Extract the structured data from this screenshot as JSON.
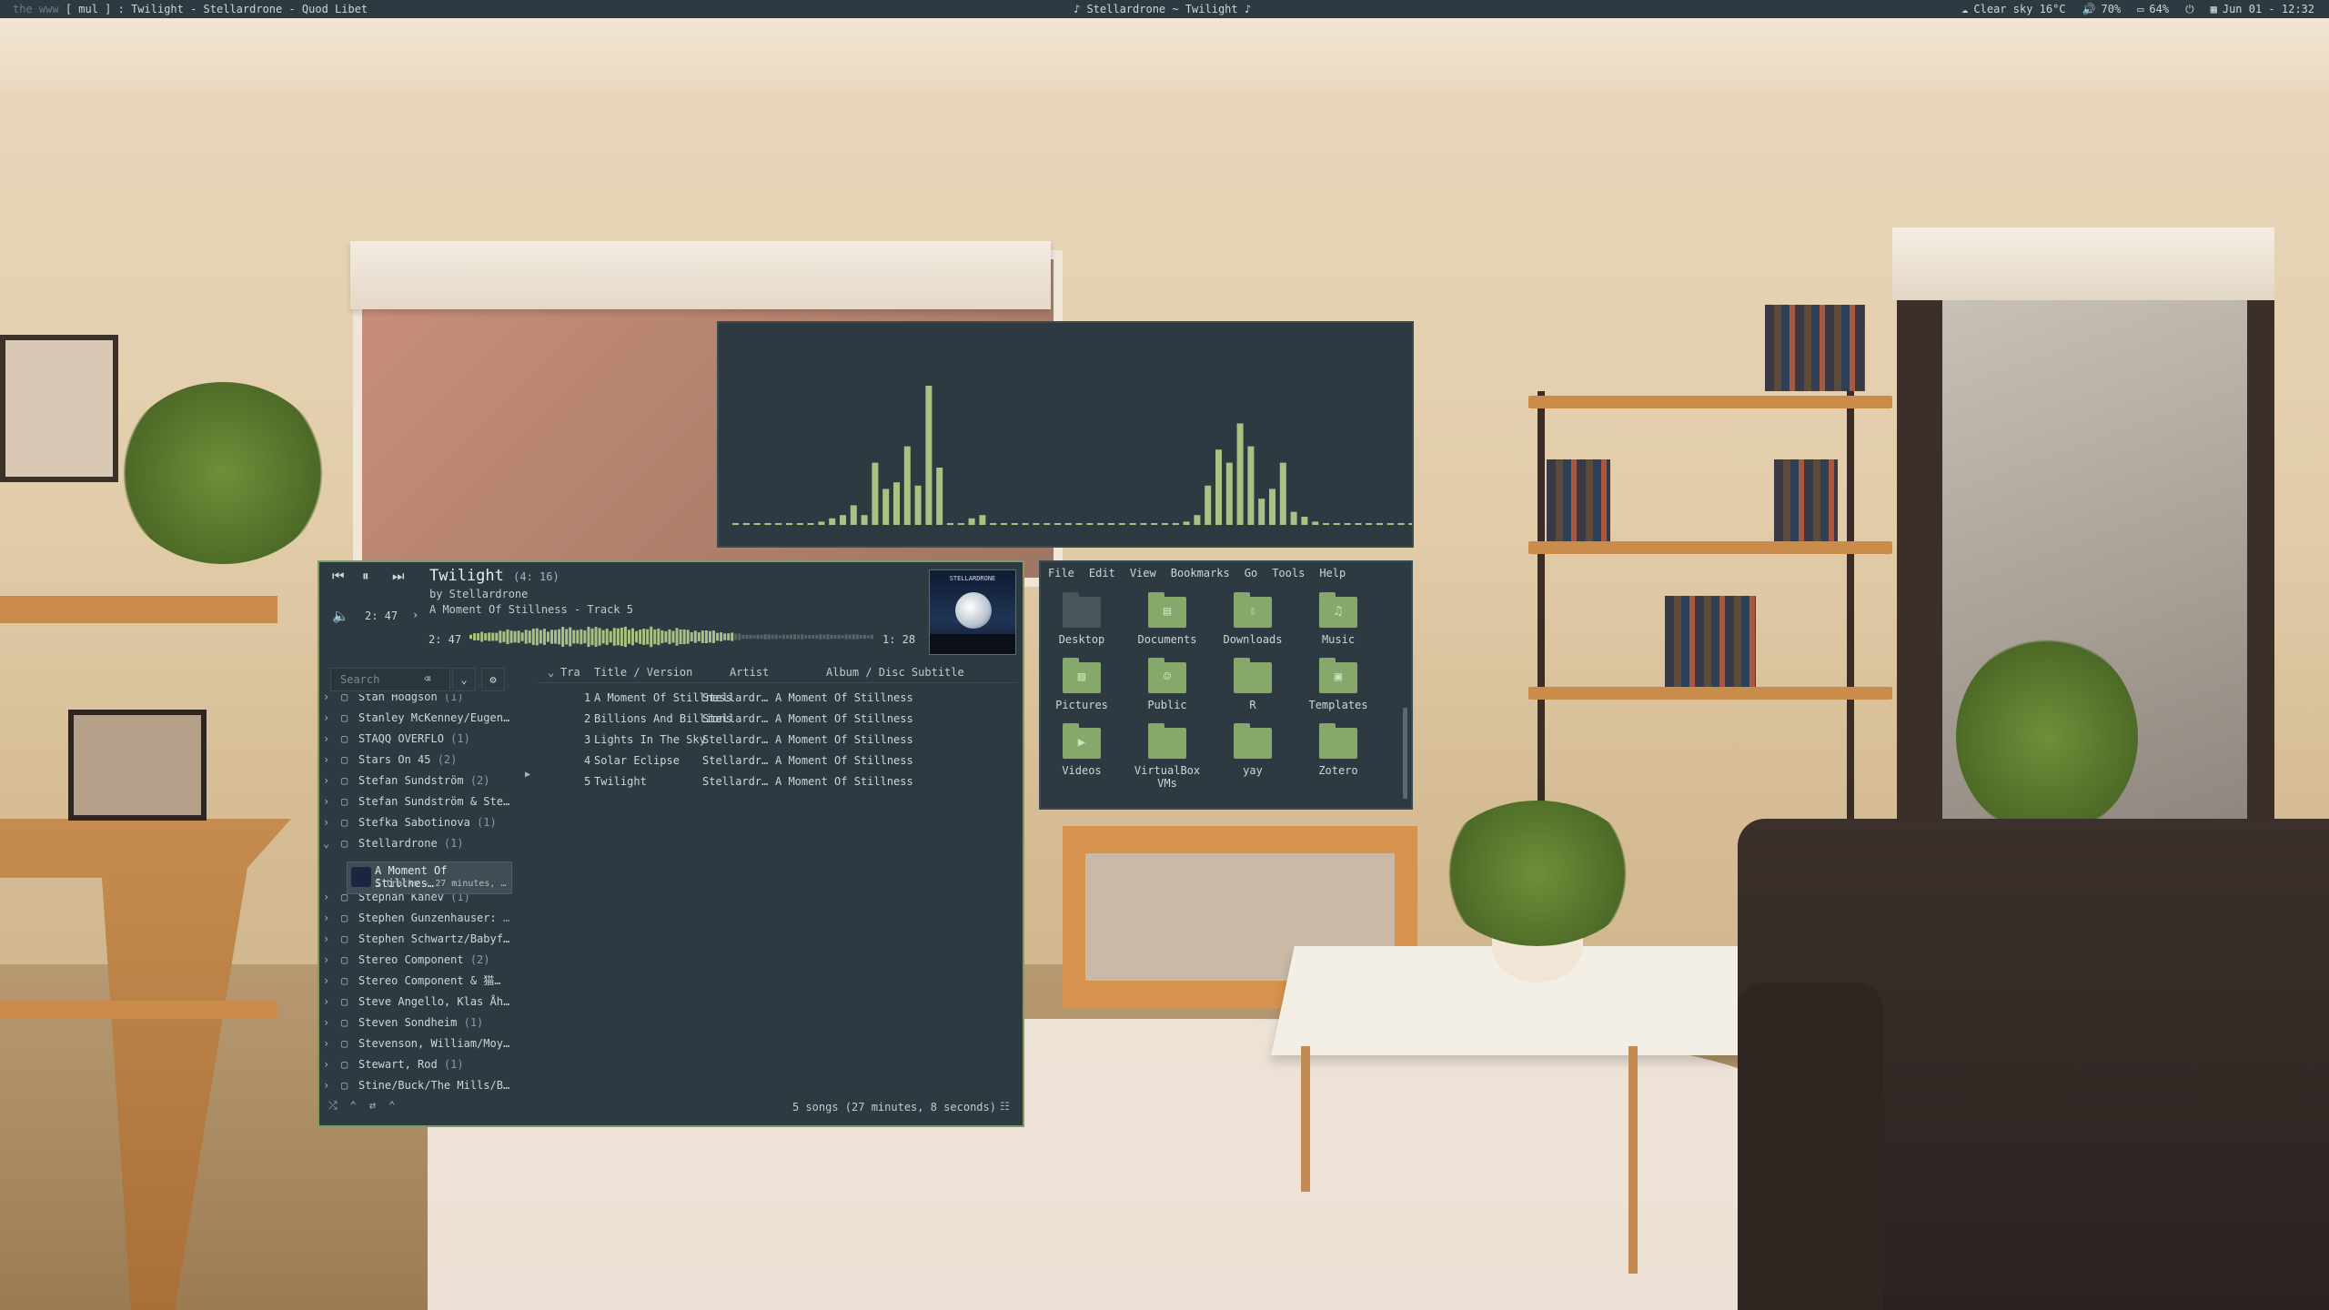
{
  "topbar": {
    "tags": "the www",
    "layout": "[ mul ]",
    "window_title": ": Twilight - Stellardrone - Quod Libet",
    "now_playing": "♪ Stellardrone ~ Twilight ♪",
    "weather": "Clear sky 16°C",
    "volume": "70%",
    "battery": "64%",
    "datetime": "Jun 01 - 12:32"
  },
  "player": {
    "title": "Twilight",
    "duration": "(4: 16)",
    "by": "by Stellardrone",
    "album": "A Moment Of Stillness - Track 5",
    "position": "2: 47",
    "elapsed": "2: 47",
    "remaining": "1: 28",
    "cover_label": "STELLARDRONE",
    "progress": 0.65,
    "search_placeholder": "Search",
    "columns": {
      "track": "Tra",
      "title": "Title / Version",
      "artist": "Artist",
      "album": "Album / Disc Subtitle"
    },
    "artists": [
      {
        "name": "Stan Hodgson",
        "count": "(1)",
        "expanded": false
      },
      {
        "name": "Stanley McKenney/Eugen…",
        "count": "",
        "expanded": false
      },
      {
        "name": "STAQQ OVERFLO",
        "count": "(1)",
        "expanded": false
      },
      {
        "name": "Stars On 45",
        "count": "(2)",
        "expanded": false
      },
      {
        "name": "Stefan Sundström",
        "count": "(2)",
        "expanded": false
      },
      {
        "name": "Stefan Sundström & Ste…",
        "count": "",
        "expanded": false
      },
      {
        "name": "Stefka Sabotinova",
        "count": "(1)",
        "expanded": false
      },
      {
        "name": "Stellardrone",
        "count": "(1)",
        "expanded": true
      },
      {
        "name": "Stephan Kanev",
        "count": "(1)",
        "expanded": false
      },
      {
        "name": "Stephen Gunzenhauser:",
        "count": "…",
        "expanded": false
      },
      {
        "name": "Stephen Schwartz/Babyf…",
        "count": "",
        "expanded": false
      },
      {
        "name": "Stereo Component",
        "count": "(2)",
        "expanded": false
      },
      {
        "name": "Stereo Component & 猫…",
        "count": "",
        "expanded": false
      },
      {
        "name": "Steve Angello, Klas Åh…",
        "count": "",
        "expanded": false
      },
      {
        "name": "Steven Sondheim",
        "count": "(1)",
        "expanded": false
      },
      {
        "name": "Stevenson, William/Moy…",
        "count": "",
        "expanded": false
      },
      {
        "name": "Stewart, Rod",
        "count": "(1)",
        "expanded": false
      },
      {
        "name": "Stine/Buck/The Mills/B…",
        "count": "",
        "expanded": false
      }
    ],
    "selected_album": {
      "name": "A Moment Of Stillnes…",
      "meta": "5 tracks - 27 minutes, …"
    },
    "tracks": [
      {
        "num": "1",
        "title": "A Moment Of Stillness",
        "artist": "Stellardr…",
        "album": "A Moment Of Stillness"
      },
      {
        "num": "2",
        "title": "Billions And Billions",
        "artist": "Stellardr…",
        "album": "A Moment Of Stillness"
      },
      {
        "num": "3",
        "title": "Lights In The Sky",
        "artist": "Stellardr…",
        "album": "A Moment Of Stillness"
      },
      {
        "num": "4",
        "title": "Solar Eclipse",
        "artist": "Stellardr…",
        "album": "A Moment Of Stillness"
      },
      {
        "num": "5",
        "title": "Twilight",
        "artist": "Stellardr…",
        "album": "A Moment Of Stillness"
      }
    ],
    "status": "5 songs (27 minutes, 8 seconds)"
  },
  "visualizer": {
    "bars": [
      0,
      0,
      0,
      0,
      0,
      0,
      0,
      0,
      0.02,
      0.04,
      0.06,
      0.12,
      0.06,
      0.38,
      0.22,
      0.26,
      0.48,
      0.24,
      0.85,
      0.35,
      0,
      0,
      0.04,
      0.06,
      0,
      0,
      0,
      0,
      0,
      0,
      0,
      0,
      0,
      0,
      0,
      0,
      0,
      0,
      0,
      0,
      0,
      0,
      0.02,
      0.06,
      0.24,
      0.46,
      0.38,
      0.62,
      0.48,
      0.16,
      0.22,
      0.38,
      0.08,
      0.05,
      0.02,
      0.01,
      0,
      0,
      0,
      0,
      0,
      0,
      0,
      0,
      0
    ],
    "color": "#a7c283"
  },
  "filemanager": {
    "menu": [
      "File",
      "Edit",
      "View",
      "Bookmarks",
      "Go",
      "Tools",
      "Help"
    ],
    "items": [
      {
        "label": "Desktop",
        "icon": "desktop-icon"
      },
      {
        "label": "Documents",
        "icon": "documents-folder-icon"
      },
      {
        "label": "Downloads",
        "icon": "downloads-folder-icon"
      },
      {
        "label": "Music",
        "icon": "music-folder-icon"
      },
      {
        "label": "Pictures",
        "icon": "pictures-folder-icon"
      },
      {
        "label": "Public",
        "icon": "public-folder-icon"
      },
      {
        "label": "R",
        "icon": "folder-icon"
      },
      {
        "label": "Templates",
        "icon": "templates-folder-icon"
      },
      {
        "label": "Videos",
        "icon": "videos-folder-icon"
      },
      {
        "label": "VirtualBox VMs",
        "icon": "folder-icon"
      },
      {
        "label": "yay",
        "icon": "folder-icon"
      },
      {
        "label": "Zotero",
        "icon": "folder-icon"
      }
    ]
  },
  "colors": {
    "accent": "#86a86a",
    "panel": "#2e3a42",
    "border": "#7f9a66"
  }
}
